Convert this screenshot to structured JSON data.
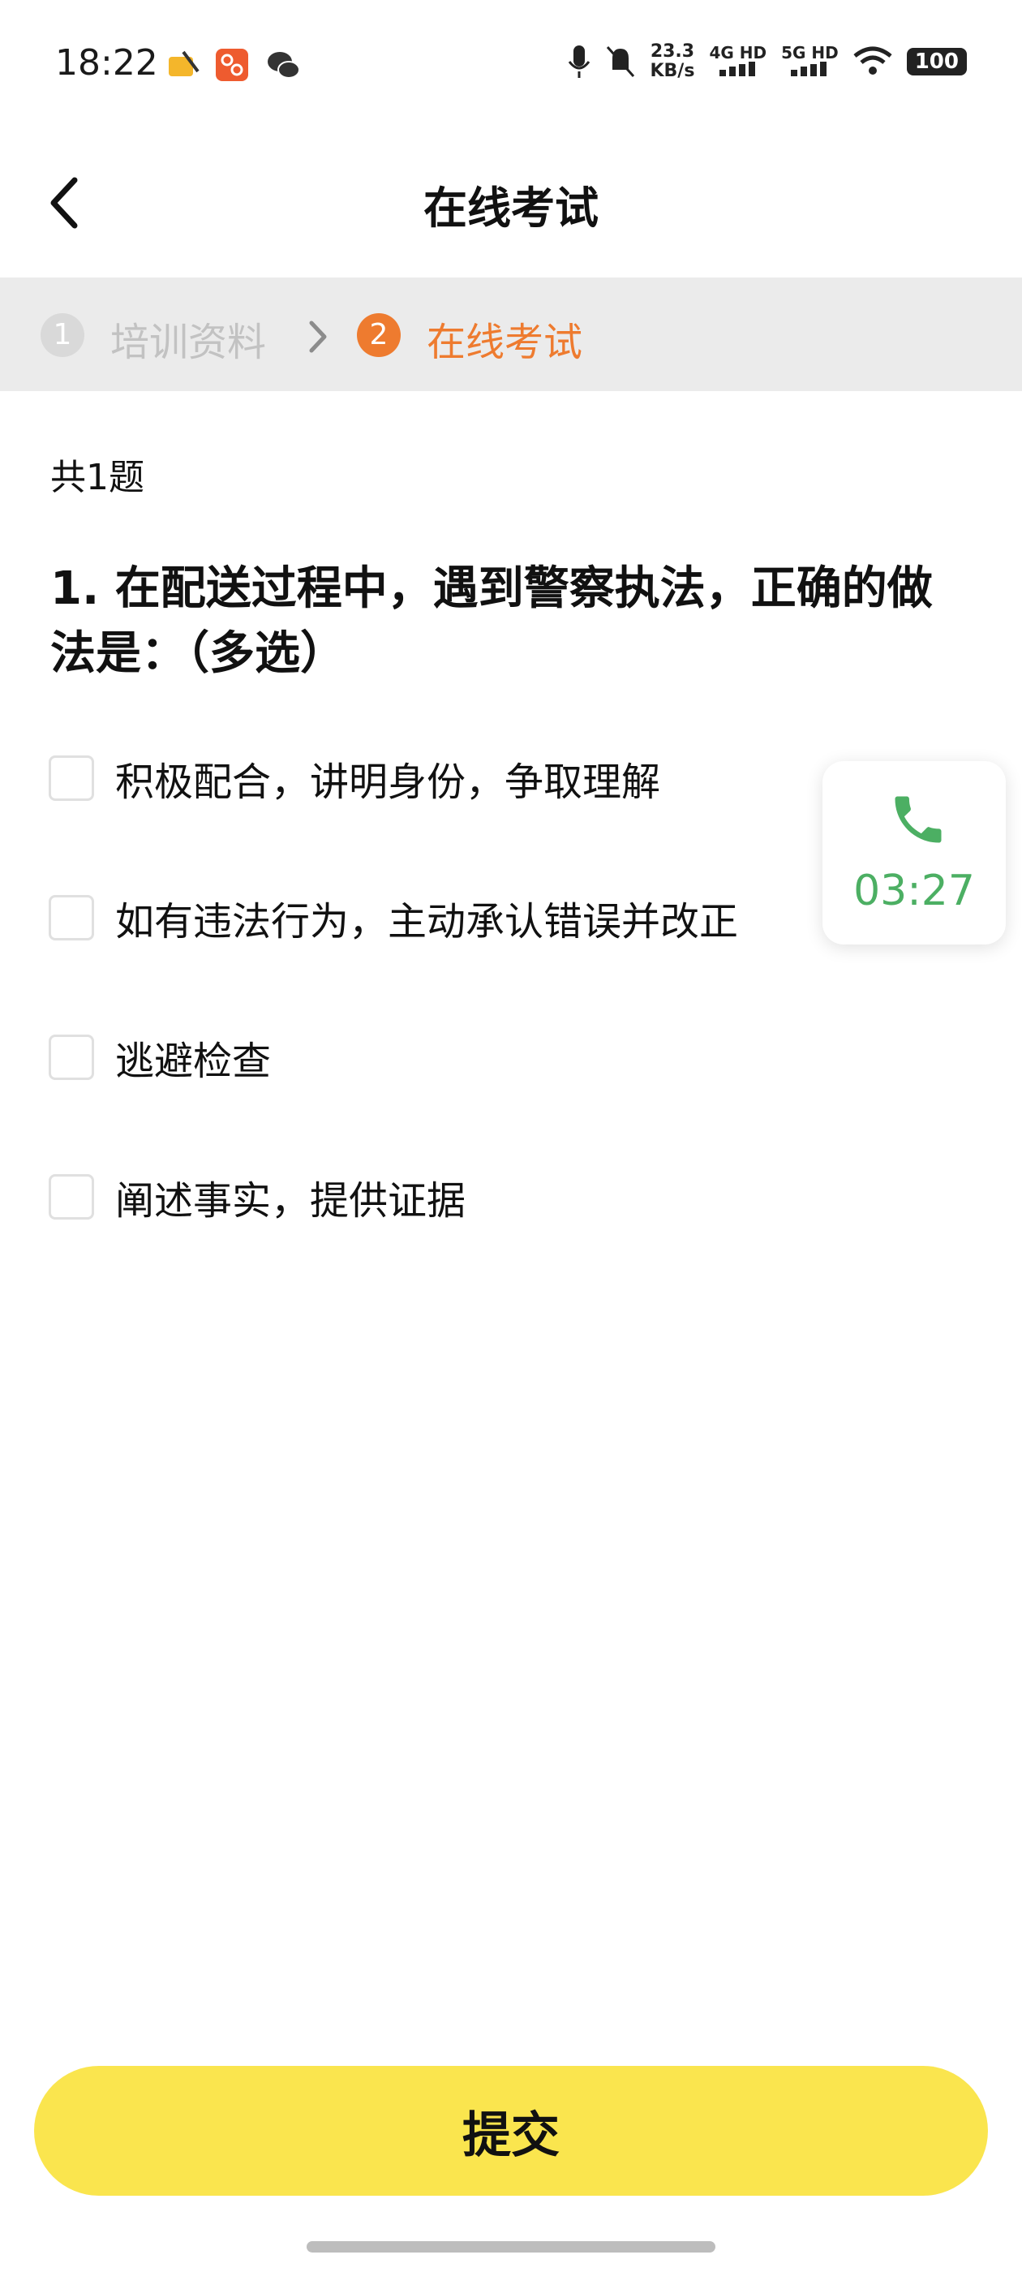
{
  "status_bar": {
    "time": "18:22",
    "speed_value": "23.3",
    "speed_unit": "KB/s",
    "net1": "4G HD",
    "net2": "5G HD",
    "battery": "100"
  },
  "nav": {
    "title": "在线考试"
  },
  "steps": {
    "step1_number": "1",
    "step1_label": "培训资料",
    "step2_number": "2",
    "step2_label": "在线考试",
    "active_color": "#ee7b2f"
  },
  "exam": {
    "count_text": "共1题",
    "question": "1. 在配送过程中，遇到警察执法，正确的做法是：（多选）",
    "options": [
      {
        "label": "积极配合，讲明身份，争取理解",
        "checked": false
      },
      {
        "label": "如有违法行为，主动承认错误并改正",
        "checked": false
      },
      {
        "label": "逃避检查",
        "checked": false
      },
      {
        "label": "阐述事实，提供证据",
        "checked": false
      }
    ]
  },
  "call": {
    "duration": "03:27",
    "color": "#4caf63"
  },
  "submit": {
    "label": "提交",
    "color": "#fae54e"
  }
}
